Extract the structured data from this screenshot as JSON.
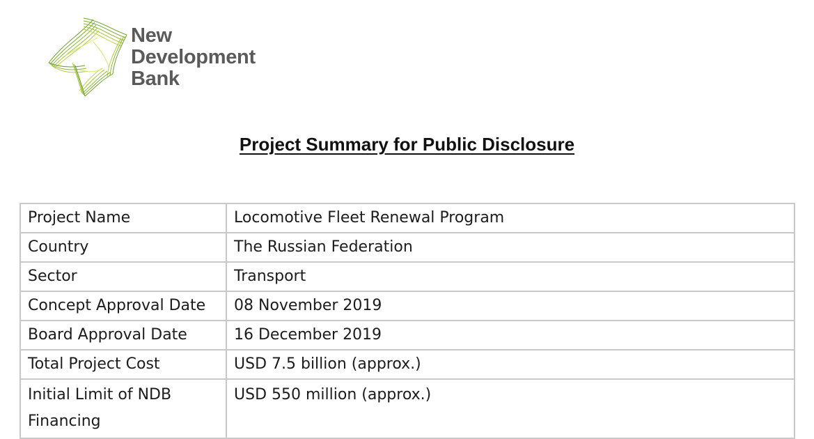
{
  "logo": {
    "name_lines": [
      "New",
      "Development",
      "Bank"
    ],
    "colors": {
      "mark_dark": "#6a9f2a",
      "mark_mid": "#a6c63a",
      "mark_light": "#d8e36a",
      "text": "#5a5a5a"
    }
  },
  "document": {
    "title": "Project Summary for Public Disclosure"
  },
  "summary_table": {
    "rows": [
      {
        "label": "Project Name",
        "value": "Locomotive Fleet Renewal Program"
      },
      {
        "label": "Country",
        "value": "The Russian Federation"
      },
      {
        "label": "Sector",
        "value": "Transport"
      },
      {
        "label": "Concept Approval Date",
        "value": "08 November 2019"
      },
      {
        "label": "Board Approval Date",
        "value": "16 December 2019"
      },
      {
        "label": "Total Project Cost",
        "value": "USD 7.5 billion (approx.)"
      },
      {
        "label": "Initial Limit of NDB Financing",
        "value": "USD 550 million (approx.)"
      }
    ]
  }
}
